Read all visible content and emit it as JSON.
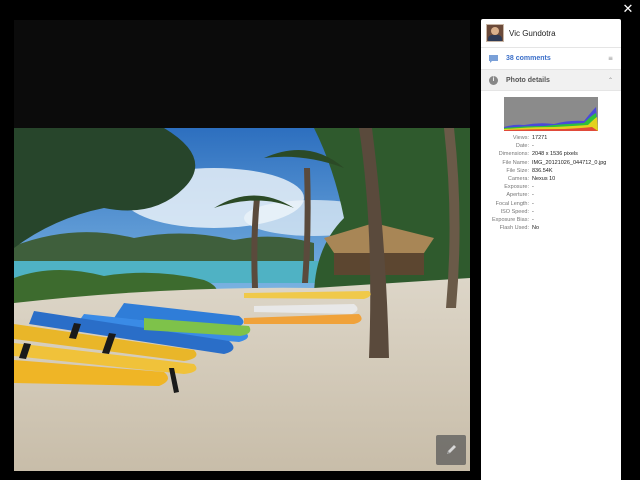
{
  "close_icon": "close-icon",
  "user": {
    "name": "Vic Gundotra"
  },
  "comments": {
    "label": "38 comments"
  },
  "details": {
    "label": "Photo details"
  },
  "metadata": [
    {
      "key": "Views:",
      "value": "17271"
    },
    {
      "key": "Date:",
      "value": "-"
    },
    {
      "key": "Dimensions:",
      "value": "2048 x 1536 pixels"
    },
    {
      "key": "File Name:",
      "value": "IMG_20121026_044712_0.jpg"
    },
    {
      "key": "File Size:",
      "value": "836.54K"
    },
    {
      "key": "Camera:",
      "value": "Nexus 10"
    },
    {
      "key": "Exposure:",
      "value": "-"
    },
    {
      "key": "Aperture:",
      "value": "-"
    },
    {
      "key": "Focal Length:",
      "value": "-"
    },
    {
      "key": "ISO Speed:",
      "value": "-"
    },
    {
      "key": "Exposure Bias:",
      "value": "-"
    },
    {
      "key": "Flash Used:",
      "value": "No"
    }
  ],
  "colors": {
    "link": "#3b6fc9",
    "panel_bg": "#ffffff",
    "viewer_bg": "#0b0b0b"
  }
}
